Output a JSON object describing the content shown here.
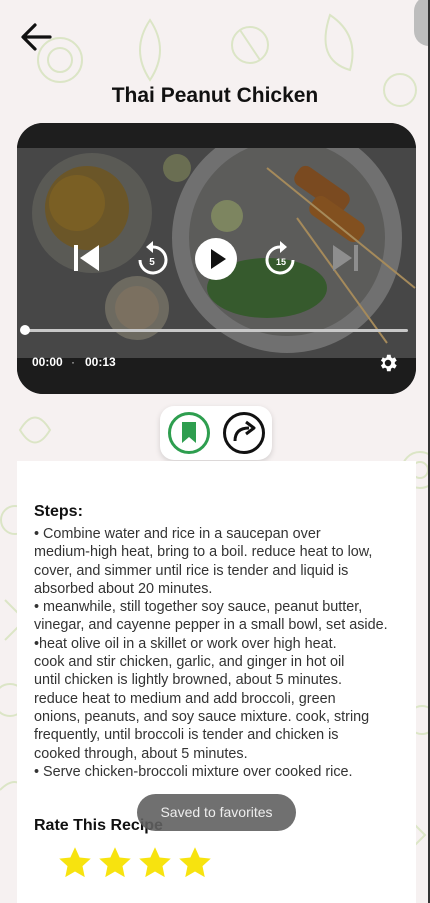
{
  "header": {
    "back_icon": "arrow-left-icon",
    "title": "Thai Peanut Chicken"
  },
  "video": {
    "current_time": "00:00",
    "separator": "·",
    "duration": "00:13",
    "progress": 0,
    "rewind_seconds": "5",
    "forward_seconds": "15",
    "icons": [
      "skip-previous-icon",
      "rewind-icon",
      "play-icon",
      "fast-forward-icon",
      "skip-next-icon",
      "settings-gear-icon"
    ]
  },
  "actions": {
    "bookmark_icon": "bookmark-icon",
    "share_icon": "share-icon",
    "accent": "#2e9e4f"
  },
  "recipe": {
    "steps_heading": "Steps:",
    "steps_text": "• Combine water and rice in a saucepan over\nmedium-high heat, bring to a boil. reduce heat to low,\ncover, and simmer until rice is tender and liquid is\nabsorbed about 20 minutes.\n• meanwhile, still together soy sauce, peanut butter,\nvinegar, and cayenne pepper in a small bowl, set aside.\n•heat olive oil in a skillet or work over high heat.\ncook and stir chicken, garlic, and ginger in hot oil\nuntil chicken is lightly browned, about 5 minutes.\nreduce heat to medium and add broccoli, green\nonions, peanuts, and soy sauce mixture. cook, string\nfrequently, until broccoli is tender and chicken is\ncooked through, about 5 minutes.\n• Serve chicken-broccoli mixture over cooked rice.",
    "rate_heading": "Rate This Recipe",
    "rating": 4,
    "star_color": "#f7e30f"
  },
  "toast": {
    "text": "Saved to favorites"
  }
}
